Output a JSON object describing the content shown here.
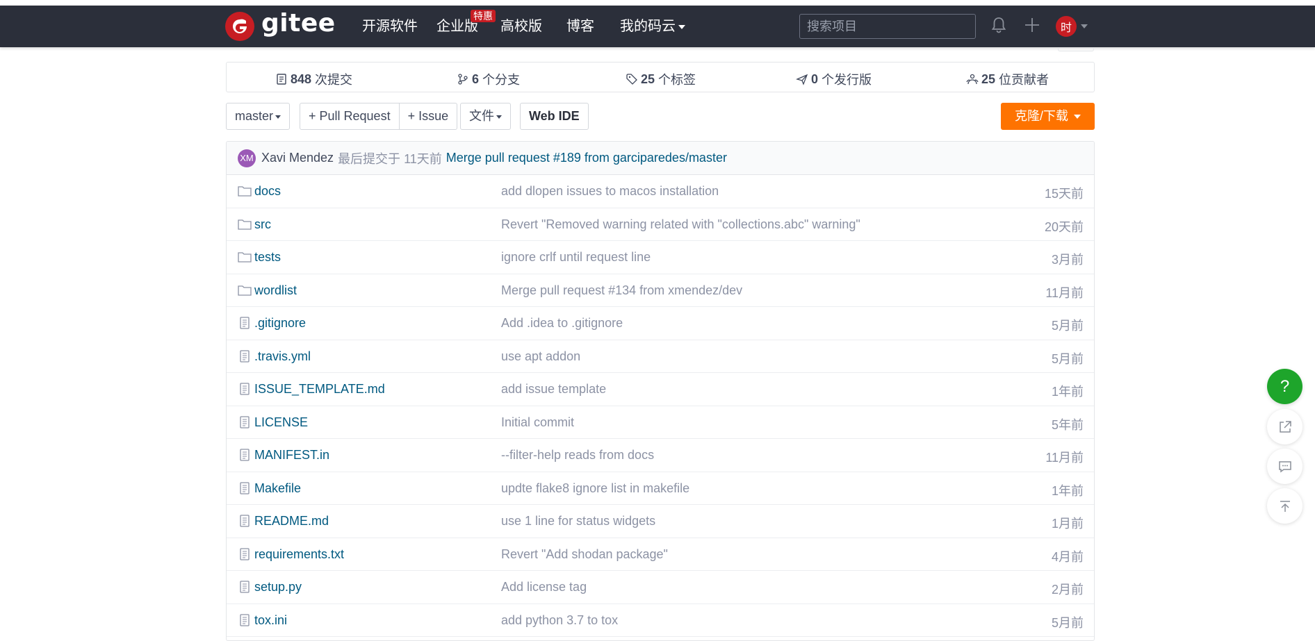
{
  "nav": {
    "logo_text": "gitee",
    "items": [
      "开源软件",
      "企业版",
      "高校版",
      "博客",
      "我的码云"
    ],
    "badge": "特惠",
    "search_placeholder": "搜索项目",
    "avatar_initial": "时"
  },
  "stats": {
    "commits": {
      "count": "848",
      "label": "次提交"
    },
    "branches": {
      "count": "6",
      "label": "个分支"
    },
    "tags": {
      "count": "25",
      "label": "个标签"
    },
    "releases": {
      "count": "0",
      "label": "个发行版"
    },
    "contributors": {
      "count": "25",
      "label": "位贡献者"
    }
  },
  "toolbar": {
    "branch": "master",
    "pull_request": "+ Pull Request",
    "issue": "+ Issue",
    "file_menu": "文件",
    "web_ide": "Web IDE",
    "clone": "克隆/下载"
  },
  "last_commit": {
    "initials": "XM",
    "author": "Xavi Mendez",
    "meta": "最后提交于 11天前",
    "message": "Merge pull request #189 from garciparedes/master"
  },
  "files": [
    {
      "type": "folder",
      "name": "docs",
      "message": "add dlopen issues to macos installation",
      "time": "15天前"
    },
    {
      "type": "folder",
      "name": "src",
      "message": "Revert \"Removed warning related with \"collections.abc\" warning\"",
      "time": "20天前"
    },
    {
      "type": "folder",
      "name": "tests",
      "message": "ignore crlf until request line",
      "time": "3月前"
    },
    {
      "type": "folder",
      "name": "wordlist",
      "message": "Merge pull request #134 from xmendez/dev",
      "time": "11月前"
    },
    {
      "type": "file",
      "name": ".gitignore",
      "message": "Add .idea to .gitignore",
      "time": "5月前"
    },
    {
      "type": "file",
      "name": ".travis.yml",
      "message": "use apt addon",
      "time": "5月前"
    },
    {
      "type": "file",
      "name": "ISSUE_TEMPLATE.md",
      "message": "add issue template",
      "time": "1年前"
    },
    {
      "type": "file",
      "name": "LICENSE",
      "message": "Initial commit",
      "time": "5年前"
    },
    {
      "type": "file",
      "name": "MANIFEST.in",
      "message": "--filter-help reads from docs",
      "time": "11月前"
    },
    {
      "type": "file",
      "name": "Makefile",
      "message": "updte flake8 ignore list in makefile",
      "time": "1年前"
    },
    {
      "type": "file",
      "name": "README.md",
      "message": "use 1 line for status widgets",
      "time": "1月前"
    },
    {
      "type": "file",
      "name": "requirements.txt",
      "message": "Revert \"Add shodan package\"",
      "time": "4月前"
    },
    {
      "type": "file",
      "name": "setup.py",
      "message": "Add license tag",
      "time": "2月前"
    },
    {
      "type": "file",
      "name": "tox.ini",
      "message": "add python 3.7 to tox",
      "time": "5月前"
    }
  ],
  "floating": {
    "help": "?"
  },
  "colors": {
    "nav_bg": "#2b2f3a",
    "brand_red": "#c71d23",
    "clone_orange": "#fe7300",
    "link_blue": "#005980",
    "help_green": "#1ea52b"
  }
}
